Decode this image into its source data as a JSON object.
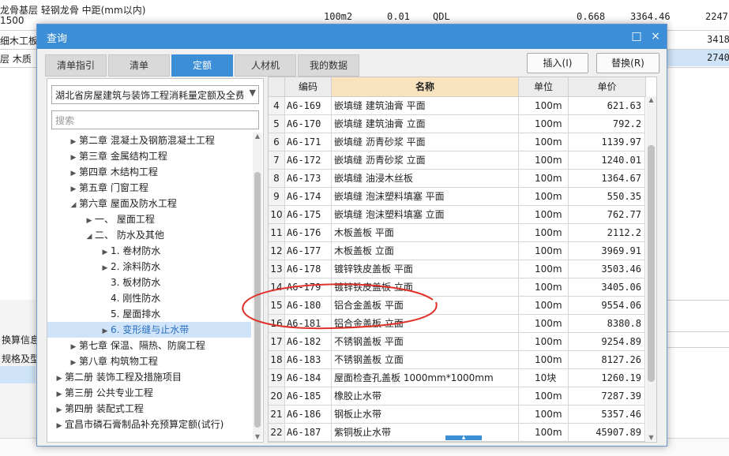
{
  "background": {
    "row1_name": "龙骨基层 轻钢龙骨 中距(mm以内)",
    "row1_sub": "1500",
    "row1_unit": "100m2",
    "row1_qty": "0.01",
    "row1_code": "QDL",
    "row1_val1": "0.668",
    "row1_val2": "3364.46",
    "row1_val3": "2247",
    "row2_name": "细木工板",
    "row2_val3": "3418",
    "row3_name": "层 木质",
    "row3_val3": "2740",
    "left_tab1": "换算信息",
    "left_tab2": "规格及型"
  },
  "dialog": {
    "title": "查询",
    "maximize_icon": "□",
    "close_icon": "×",
    "tabs": [
      "清单指引",
      "清单",
      "定额",
      "人材机",
      "我的数据"
    ],
    "active_tab": "定额",
    "insert_button": "插入(I)",
    "replace_button": "替换(R)"
  },
  "left_panel": {
    "selected_library": "湖北省房屋建筑与装饰工程消耗量定额及全费用",
    "search_placeholder": "搜索",
    "tree": [
      {
        "label": "第二章 混凝土及钢筋混凝土工程",
        "level": 2,
        "caret": "right"
      },
      {
        "label": "第三章 金属结构工程",
        "level": 2,
        "caret": "right"
      },
      {
        "label": "第四章 木结构工程",
        "level": 2,
        "caret": "right"
      },
      {
        "label": "第五章 门窗工程",
        "level": 2,
        "caret": "right"
      },
      {
        "label": "第六章 屋面及防水工程",
        "level": 2,
        "caret": "down"
      },
      {
        "label": "一、 屋面工程",
        "level": 3,
        "caret": "right"
      },
      {
        "label": "二、 防水及其他",
        "level": 3,
        "caret": "down"
      },
      {
        "label": "1. 卷材防水",
        "level": 4,
        "caret": "right"
      },
      {
        "label": "2. 涂料防水",
        "level": 4,
        "caret": "right"
      },
      {
        "label": "3. 板材防水",
        "level": 4,
        "caret": "none"
      },
      {
        "label": "4. 刚性防水",
        "level": 4,
        "caret": "none"
      },
      {
        "label": "5. 屋面排水",
        "level": 4,
        "caret": "none"
      },
      {
        "label": "6. 变形缝与止水带",
        "level": 4,
        "caret": "right",
        "selected": true
      },
      {
        "label": "第七章 保温、隔热、防腐工程",
        "level": 2,
        "caret": "right"
      },
      {
        "label": "第八章 构筑物工程",
        "level": 2,
        "caret": "right"
      },
      {
        "label": "第二册 装饰工程及措施项目",
        "level": 1,
        "caret": "right"
      },
      {
        "label": "第三册 公共专业工程",
        "level": 1,
        "caret": "right"
      },
      {
        "label": "第四册 装配式工程",
        "level": 1,
        "caret": "right"
      },
      {
        "label": "宜昌市磷石膏制品补充预算定额(试行)",
        "level": 1,
        "caret": "right"
      }
    ]
  },
  "grid": {
    "headers": {
      "code": "编码",
      "name": "名称",
      "unit": "单位",
      "price": "单价"
    },
    "rows": [
      {
        "idx": "4",
        "code": "A6-169",
        "name": "嵌填缝 建筑油膏 平面",
        "unit": "100m",
        "price": "621.63"
      },
      {
        "idx": "5",
        "code": "A6-170",
        "name": "嵌填缝 建筑油膏 立面",
        "unit": "100m",
        "price": "792.2"
      },
      {
        "idx": "6",
        "code": "A6-171",
        "name": "嵌填缝 沥青砂浆 平面",
        "unit": "100m",
        "price": "1139.97"
      },
      {
        "idx": "7",
        "code": "A6-172",
        "name": "嵌填缝 沥青砂浆 立面",
        "unit": "100m",
        "price": "1240.01"
      },
      {
        "idx": "8",
        "code": "A6-173",
        "name": "嵌填缝 油浸木丝板",
        "unit": "100m",
        "price": "1364.67"
      },
      {
        "idx": "9",
        "code": "A6-174",
        "name": "嵌填缝 泡沫塑料填塞 平面",
        "unit": "100m",
        "price": "550.35"
      },
      {
        "idx": "10",
        "code": "A6-175",
        "name": "嵌填缝 泡沫塑料填塞 立面",
        "unit": "100m",
        "price": "762.77"
      },
      {
        "idx": "11",
        "code": "A6-176",
        "name": "木板盖板 平面",
        "unit": "100m",
        "price": "2112.2"
      },
      {
        "idx": "12",
        "code": "A6-177",
        "name": "木板盖板 立面",
        "unit": "100m",
        "price": "3969.91"
      },
      {
        "idx": "13",
        "code": "A6-178",
        "name": "镀锌铁皮盖板 平面",
        "unit": "100m",
        "price": "3503.46"
      },
      {
        "idx": "14",
        "code": "A6-179",
        "name": "镀锌铁皮盖板 立面",
        "unit": "100m",
        "price": "3405.06"
      },
      {
        "idx": "15",
        "code": "A6-180",
        "name": "铝合金盖板 平面",
        "unit": "100m",
        "price": "9554.06"
      },
      {
        "idx": "16",
        "code": "A6-181",
        "name": "铝合金盖板 立面",
        "unit": "100m",
        "price": "8380.8"
      },
      {
        "idx": "17",
        "code": "A6-182",
        "name": "不锈钢盖板 平面",
        "unit": "100m",
        "price": "9254.89"
      },
      {
        "idx": "18",
        "code": "A6-183",
        "name": "不锈钢盖板 立面",
        "unit": "100m",
        "price": "8127.26"
      },
      {
        "idx": "19",
        "code": "A6-184",
        "name": "屋面检查孔盖板 1000mm*1000mm",
        "unit": "10块",
        "price": "1260.19"
      },
      {
        "idx": "20",
        "code": "A6-185",
        "name": "橡胶止水带",
        "unit": "100m",
        "price": "7287.39"
      },
      {
        "idx": "21",
        "code": "A6-186",
        "name": "钢板止水带",
        "unit": "100m",
        "price": "5357.46"
      },
      {
        "idx": "22",
        "code": "A6-187",
        "name": "紫铜板止水带",
        "unit": "100m",
        "price": "45907.89"
      }
    ]
  },
  "colors": {
    "accent": "#3c8fd6",
    "header_name": "#f9e3bf",
    "annotation": "#e0302a",
    "selected_row": "#cfe4f8"
  }
}
